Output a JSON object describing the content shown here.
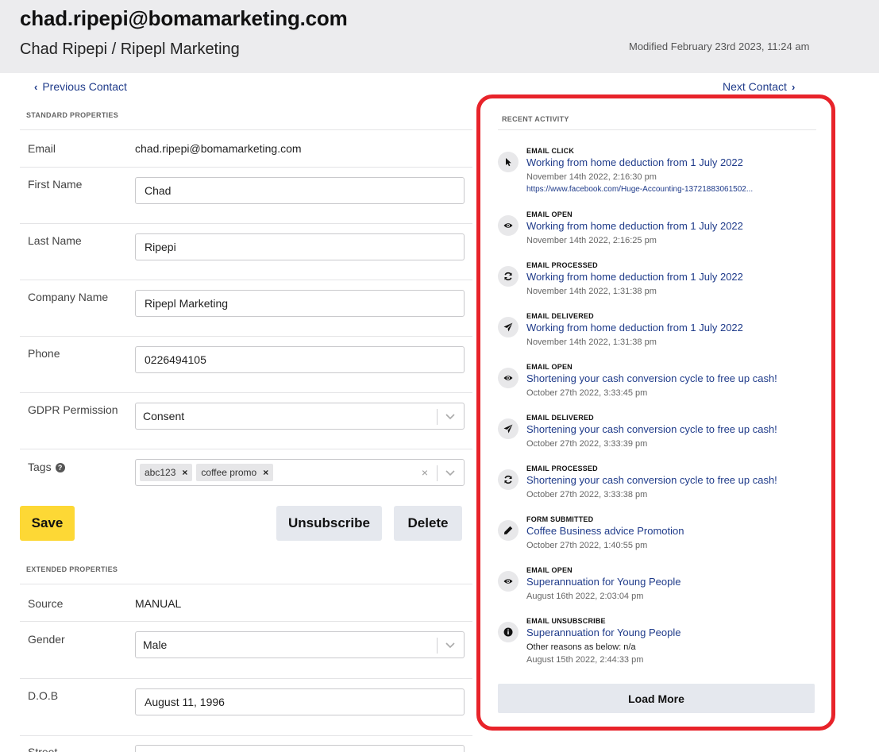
{
  "header": {
    "email": "chad.ripepi@bomamarketing.com",
    "name": "Chad Ripepi / Ripepl Marketing",
    "modified": "Modified February 23rd 2023, 11:24 am"
  },
  "nav": {
    "previous": "Previous Contact",
    "next": "Next Contact"
  },
  "standard_properties": {
    "title": "STANDARD PROPERTIES",
    "email_label": "Email",
    "email_value": "chad.ripepi@bomamarketing.com",
    "first_name_label": "First Name",
    "first_name_value": "Chad",
    "last_name_label": "Last Name",
    "last_name_value": "Ripepi",
    "company_label": "Company Name",
    "company_value": "Ripepl Marketing",
    "phone_label": "Phone",
    "phone_value": "0226494105",
    "gdpr_label": "GDPR Permission",
    "gdpr_value": "Consent",
    "tags_label": "Tags",
    "tags": [
      "abc123",
      "coffee promo"
    ]
  },
  "buttons": {
    "save": "Save",
    "unsubscribe": "Unsubscribe",
    "delete": "Delete"
  },
  "extended_properties": {
    "title": "EXTENDED PROPERTIES",
    "source_label": "Source",
    "source_value": "MANUAL",
    "gender_label": "Gender",
    "gender_value": "Male",
    "dob_label": "D.O.B",
    "dob_value": "August 11, 1996",
    "street_label": "Street"
  },
  "activity": {
    "title": "RECENT ACTIVITY",
    "load_more": "Load More",
    "items": [
      {
        "type": "EMAIL CLICK",
        "icon": "cursor-icon",
        "title": "Working from home deduction from 1 July 2022",
        "time": "November 14th 2022, 2:16:30 pm",
        "url": "https://www.facebook.com/Huge-Accounting-13721883061502..."
      },
      {
        "type": "EMAIL OPEN",
        "icon": "eye-icon",
        "title": "Working from home deduction from 1 July 2022",
        "time": "November 14th 2022, 2:16:25 pm"
      },
      {
        "type": "EMAIL PROCESSED",
        "icon": "refresh-icon",
        "title": "Working from home deduction from 1 July 2022",
        "time": "November 14th 2022, 1:31:38 pm"
      },
      {
        "type": "EMAIL DELIVERED",
        "icon": "paper-plane-icon",
        "title": "Working from home deduction from 1 July 2022",
        "time": "November 14th 2022, 1:31:38 pm"
      },
      {
        "type": "EMAIL OPEN",
        "icon": "eye-icon",
        "title": "Shortening your cash conversion cycle to free up cash!",
        "time": "October 27th 2022, 3:33:45 pm"
      },
      {
        "type": "EMAIL DELIVERED",
        "icon": "paper-plane-icon",
        "title": "Shortening your cash conversion cycle to free up cash!",
        "time": "October 27th 2022, 3:33:39 pm"
      },
      {
        "type": "EMAIL PROCESSED",
        "icon": "refresh-icon",
        "title": "Shortening your cash conversion cycle to free up cash!",
        "time": "October 27th 2022, 3:33:38 pm"
      },
      {
        "type": "FORM SUBMITTED",
        "icon": "pencil-icon",
        "title": "Coffee Business advice Promotion",
        "time": "October 27th 2022, 1:40:55 pm"
      },
      {
        "type": "EMAIL OPEN",
        "icon": "eye-icon",
        "title": "Superannuation for Young People",
        "time": "August 16th 2022, 2:03:04 pm"
      },
      {
        "type": "EMAIL UNSUBSCRIBE",
        "icon": "info-icon",
        "title": "Superannuation for Young People",
        "note": "Other reasons as below: n/a",
        "time": "August 15th 2022, 2:44:33 pm"
      }
    ]
  }
}
